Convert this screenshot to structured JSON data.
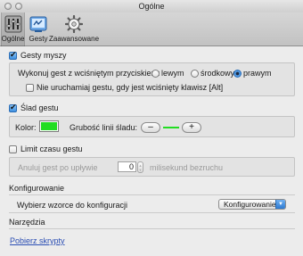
{
  "window": {
    "title": "Ogólne"
  },
  "toolbar": {
    "tabs": [
      {
        "label": "Ogólne",
        "icon": "general-prefs-icon",
        "selected": true
      },
      {
        "label": "Gesty",
        "icon": "gestures-icon",
        "selected": false
      },
      {
        "label": "Zaawansowane",
        "icon": "gear-icon",
        "selected": false
      }
    ]
  },
  "mouse_gestures": {
    "checkbox_label": "Gesty myszy",
    "checked": true,
    "button_prompt": "Wykonuj gest z wciśniętym przyciskiem:",
    "options": [
      {
        "label": "lewym",
        "selected": false
      },
      {
        "label": "środkowym",
        "selected": false
      },
      {
        "label": "prawym",
        "selected": true
      }
    ],
    "alt_label": "Nie uruchamiaj gestu, gdy jest wciśnięty klawisz [Alt]",
    "alt_checked": false
  },
  "trail": {
    "checkbox_label": "Ślad gestu",
    "checked": true,
    "color_label": "Kolor:",
    "color": "#22dd22",
    "width_label": "Grubość linii śladu:",
    "minus_label": "–",
    "plus_label": "+"
  },
  "timeout": {
    "checkbox_label": "Limit czasu gestu",
    "checked": false,
    "cancel_label": "Anuluj gest po upływie",
    "value": "0",
    "unit_label": "milisekund bezruchu"
  },
  "config": {
    "heading": "Konfigurowanie",
    "row_label": "Wybierz wzorce do konfiguracji",
    "popup_value": "Konfigurowanie"
  },
  "tools": {
    "heading": "Narzędzia",
    "link_label": "Pobierz skrypty"
  }
}
